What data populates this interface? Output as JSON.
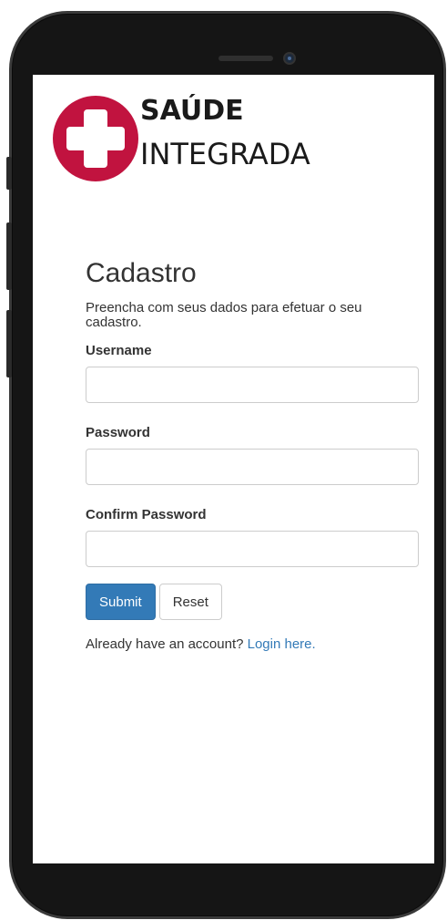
{
  "logo": {
    "line1": "SAÚDE",
    "line2": "INTEGRADA",
    "accent_color": "#c1133f",
    "icon": "medical-cross-icon"
  },
  "form": {
    "title": "Cadastro",
    "subtitle": "Preencha com seus dados para efetuar o seu cadastro.",
    "username_label": "Username",
    "username_value": "",
    "password_label": "Password",
    "password_value": "",
    "confirm_label": "Confirm Password",
    "confirm_value": "",
    "submit_label": "Submit",
    "reset_label": "Reset",
    "footer_text": "Already have an account? ",
    "login_link": "Login here."
  },
  "colors": {
    "primary": "#337ab7",
    "text": "#333333",
    "border": "#cccccc"
  }
}
